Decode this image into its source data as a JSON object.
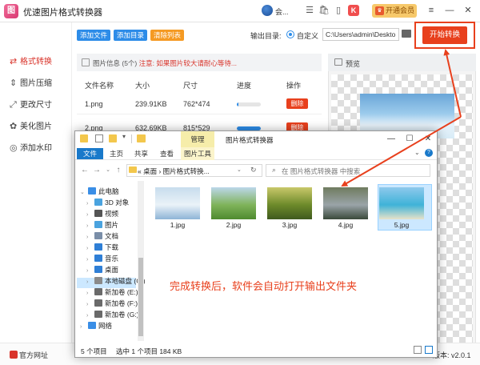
{
  "app": {
    "title": "优速图片格式转换器",
    "user_name": "会...",
    "vip_label": "开通会员",
    "vip_crown": "♛",
    "logo_glyph": "图",
    "k_badge": "K"
  },
  "sidebar": {
    "items": [
      {
        "label": "格式转换",
        "icon": "refresh-icon",
        "glyph": "⇄",
        "active": true
      },
      {
        "label": "图片压缩",
        "icon": "compress-icon",
        "glyph": "⇕",
        "active": false
      },
      {
        "label": "更改尺寸",
        "icon": "resize-icon",
        "glyph": "⤢",
        "active": false
      },
      {
        "label": "美化图片",
        "icon": "beautify-icon",
        "glyph": "✿",
        "active": false
      },
      {
        "label": "添加水印",
        "icon": "watermark-icon",
        "glyph": "◎",
        "active": false
      }
    ]
  },
  "toolbar": {
    "add_file": "添加文件",
    "add_folder": "添加目录",
    "clear_list": "清除列表",
    "output_label": "输出目录:",
    "custom_label": "自定义",
    "output_path": "C:\\Users\\admin\\Deskto",
    "start_button": "开始转换"
  },
  "list": {
    "info_prefix": "图片信息 (5个)",
    "info_warning": "注意: 如果图片较大请耐心等待...",
    "columns": {
      "name": "文件名称",
      "size": "大小",
      "dims": "尺寸",
      "progress": "进度",
      "action": "操作"
    },
    "rows": [
      {
        "name": "1.png",
        "size": "239.91KB",
        "dims": "762*474",
        "progress_pct": 8,
        "action": "删除"
      },
      {
        "name": "2.png",
        "size": "632.69KB",
        "dims": "815*529",
        "progress_pct": 100,
        "action": "删除"
      }
    ]
  },
  "preview": {
    "label": "预览"
  },
  "footer": {
    "website": "官方网址",
    "version": "版本: v2.0.1"
  },
  "explorer": {
    "manage_tab": "管理",
    "window_title": "图片格式转换器",
    "ribbon_tabs": {
      "file": "文件",
      "home": "主页",
      "share": "共享",
      "view": "查看",
      "tools": "图片工具"
    },
    "address": "« 桌面 › 图片格式转换...",
    "search_placeholder": "在 图片格式转换器 中搜索",
    "tree": [
      {
        "label": "此电脑",
        "icon": "computer-icon",
        "color": "#3a8ee6",
        "indent": 0,
        "expanded": true
      },
      {
        "label": "3D 对象",
        "icon": "cube-icon",
        "color": "#4aa3df",
        "indent": 1
      },
      {
        "label": "视频",
        "icon": "video-icon",
        "color": "#555555",
        "indent": 1
      },
      {
        "label": "图片",
        "icon": "picture-icon",
        "color": "#4aa3df",
        "indent": 1
      },
      {
        "label": "文档",
        "icon": "document-icon",
        "color": "#7a8ea8",
        "indent": 1
      },
      {
        "label": "下载",
        "icon": "download-icon",
        "color": "#2f7fd6",
        "indent": 1
      },
      {
        "label": "音乐",
        "icon": "music-icon",
        "color": "#2f7fd6",
        "indent": 1
      },
      {
        "label": "桌面",
        "icon": "desktop-icon",
        "color": "#2f7fd6",
        "indent": 1
      },
      {
        "label": "本地磁盘 (C:)",
        "icon": "drive-icon",
        "color": "#8a8a8a",
        "indent": 1,
        "selected": true
      },
      {
        "label": "新加卷 (E:)",
        "icon": "drive-icon",
        "color": "#6a6a6a",
        "indent": 1
      },
      {
        "label": "新加卷 (F:)",
        "icon": "drive-icon",
        "color": "#6a6a6a",
        "indent": 1
      },
      {
        "label": "新加卷 (G:)",
        "icon": "drive-icon",
        "color": "#6a6a6a",
        "indent": 1
      },
      {
        "label": "网络",
        "icon": "network-icon",
        "color": "#3a8ee6",
        "indent": 0
      }
    ],
    "files": [
      {
        "name": "1.jpg",
        "palette": [
          "#c7dced",
          "#eaf2f8",
          "#8eb4d6"
        ]
      },
      {
        "name": "2.jpg",
        "palette": [
          "#bcd7ea",
          "#7fb35a",
          "#4f8a2f"
        ]
      },
      {
        "name": "3.jpg",
        "palette": [
          "#c9c86a",
          "#6d8a2a",
          "#3f5a1e"
        ]
      },
      {
        "name": "4.jpg",
        "palette": [
          "#6f7b5f",
          "#9aa4a8",
          "#3a4a3a"
        ]
      },
      {
        "name": "5.jpg",
        "palette": [
          "#8ec9ec",
          "#3fb3d8",
          "#e7e2c9"
        ]
      }
    ],
    "status": {
      "count": "5 个项目",
      "selected": "选中 1 个项目  184 KB"
    }
  },
  "annotation": {
    "message": "完成转换后，软件会自动打开输出文件夹"
  },
  "colors": {
    "accent_red": "#e8401d",
    "accent_blue": "#2d8ce8",
    "accent_orange": "#f59a23"
  }
}
